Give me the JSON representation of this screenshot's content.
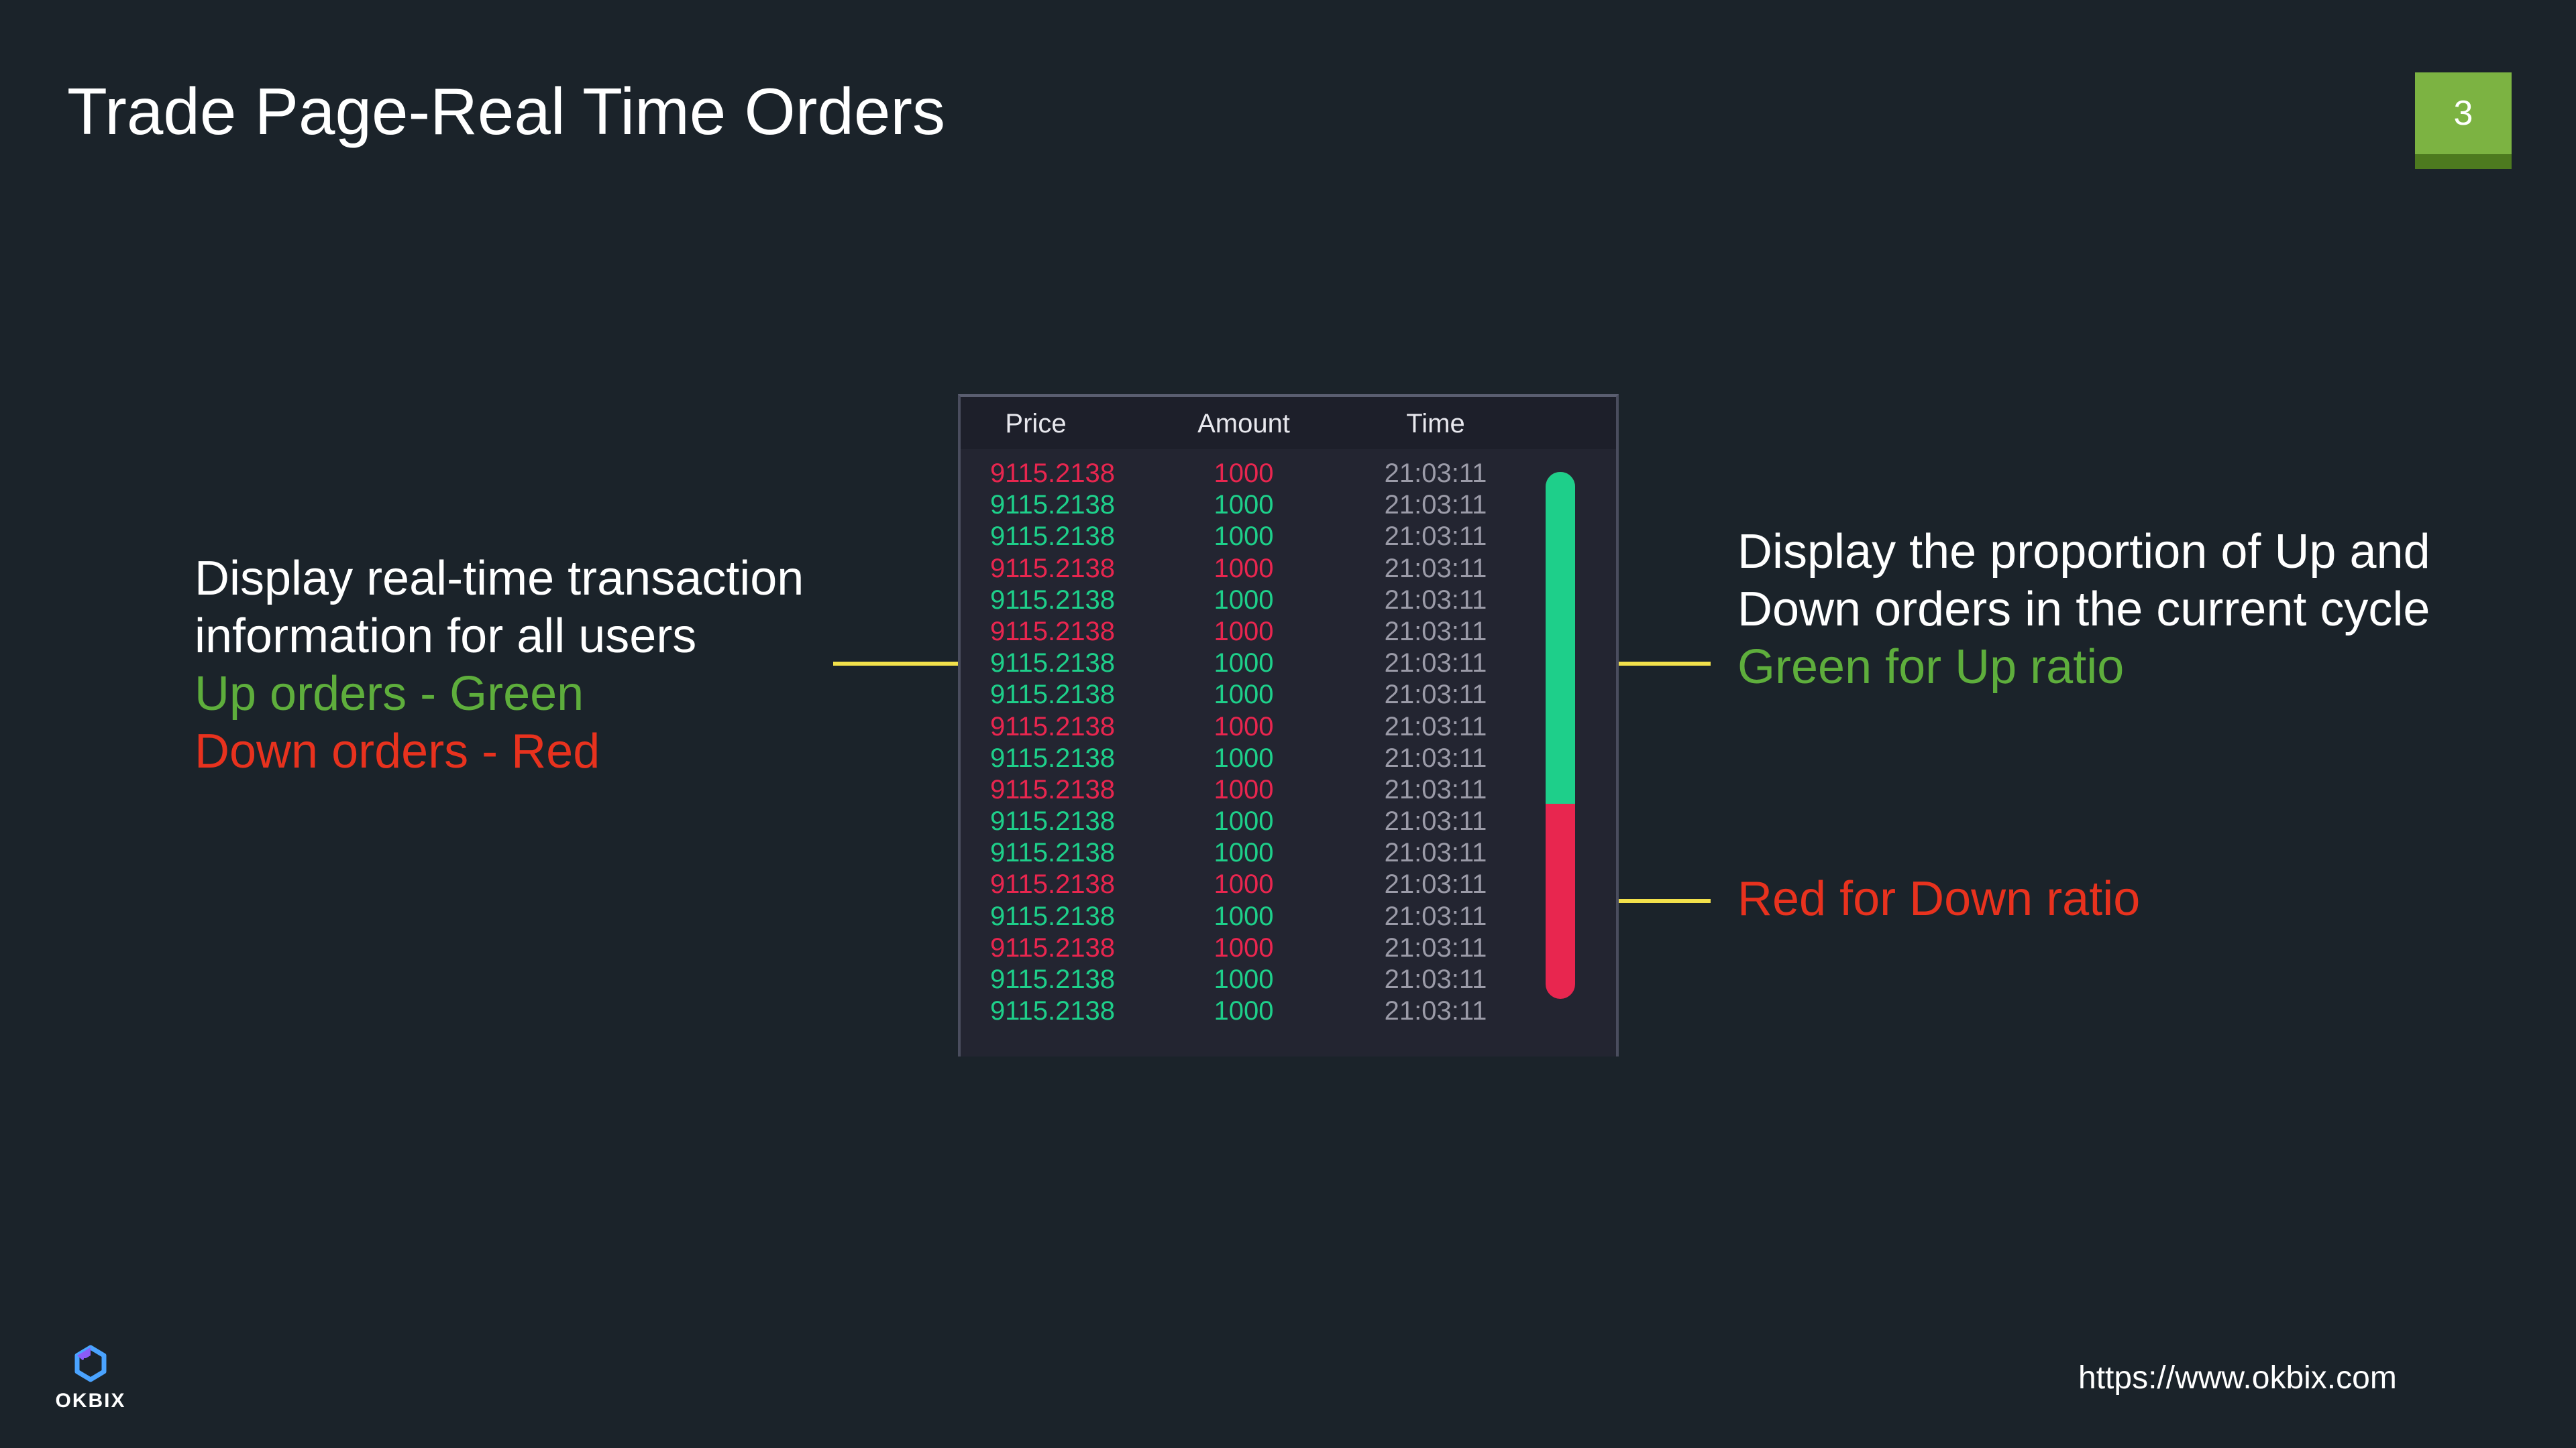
{
  "slide": {
    "title": "Trade Page-Real Time Orders",
    "page_number": "3"
  },
  "colors": {
    "background": "#1b232a",
    "badge": "#7cb342",
    "up_green": "#1ecf8a",
    "down_red": "#e8264f",
    "note_green": "#5eae3c",
    "note_red": "#e8321e",
    "connector_yellow": "#f2e14b"
  },
  "left_note": {
    "line1": "Display real-time transaction",
    "line2": "information for all users",
    "line3": "Up orders - Green",
    "line4": "Down orders - Red"
  },
  "right_note": {
    "line1": "Display the proportion of Up and",
    "line2": "Down orders in the current cycle",
    "line3": "Green for Up ratio"
  },
  "red_note": {
    "line1": "Red for Down ratio"
  },
  "trades": {
    "headers": {
      "price": "Price",
      "amount": "Amount",
      "time": "Time"
    },
    "rows": [
      {
        "side": "down",
        "price": "9115.2138",
        "amount": "1000",
        "time": "21:03:11"
      },
      {
        "side": "up",
        "price": "9115.2138",
        "amount": "1000",
        "time": "21:03:11"
      },
      {
        "side": "up",
        "price": "9115.2138",
        "amount": "1000",
        "time": "21:03:11"
      },
      {
        "side": "down",
        "price": "9115.2138",
        "amount": "1000",
        "time": "21:03:11"
      },
      {
        "side": "up",
        "price": "9115.2138",
        "amount": "1000",
        "time": "21:03:11"
      },
      {
        "side": "down",
        "price": "9115.2138",
        "amount": "1000",
        "time": "21:03:11"
      },
      {
        "side": "up",
        "price": "9115.2138",
        "amount": "1000",
        "time": "21:03:11"
      },
      {
        "side": "up",
        "price": "9115.2138",
        "amount": "1000",
        "time": "21:03:11"
      },
      {
        "side": "down",
        "price": "9115.2138",
        "amount": "1000",
        "time": "21:03:11"
      },
      {
        "side": "up",
        "price": "9115.2138",
        "amount": "1000",
        "time": "21:03:11"
      },
      {
        "side": "down",
        "price": "9115.2138",
        "amount": "1000",
        "time": "21:03:11"
      },
      {
        "side": "up",
        "price": "9115.2138",
        "amount": "1000",
        "time": "21:03:11"
      },
      {
        "side": "up",
        "price": "9115.2138",
        "amount": "1000",
        "time": "21:03:11"
      },
      {
        "side": "down",
        "price": "9115.2138",
        "amount": "1000",
        "time": "21:03:11"
      },
      {
        "side": "up",
        "price": "9115.2138",
        "amount": "1000",
        "time": "21:03:11"
      },
      {
        "side": "down",
        "price": "9115.2138",
        "amount": "1000",
        "time": "21:03:11"
      },
      {
        "side": "up",
        "price": "9115.2138",
        "amount": "1000",
        "time": "21:03:11"
      },
      {
        "side": "up",
        "price": "9115.2138",
        "amount": "1000",
        "time": "21:03:11"
      }
    ],
    "up_ratio": 0.63
  },
  "footer": {
    "logo_text": "OKBIX",
    "url": "https://www.okbix.com"
  }
}
